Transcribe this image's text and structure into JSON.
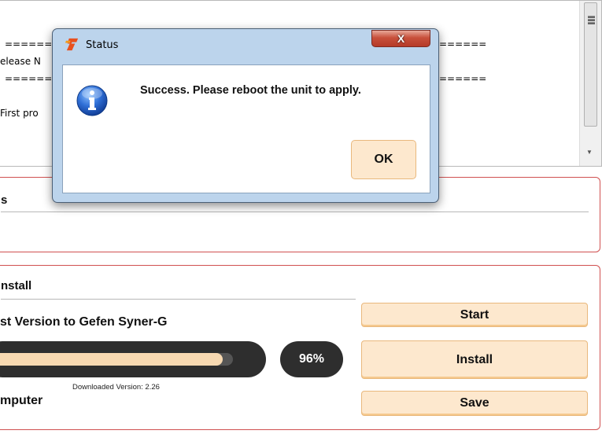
{
  "release_notes": {
    "separator_left": "======",
    "separator_right": "======",
    "release_label_fragment": "elease N",
    "first_line_fragment": "First pro"
  },
  "status_panel": {
    "title_fragment": "s"
  },
  "install_panel": {
    "title_fragment": "nstall",
    "install_latest_label": "st Version to Gefen Syner-G",
    "progress": {
      "fraction": 0.96,
      "label": "96%"
    },
    "downloaded_version": "Downloaded Version: 2.26",
    "computer_label": "mputer",
    "buttons": {
      "start": "Start",
      "install": "Install",
      "save": "Save"
    }
  },
  "dialog": {
    "title": "Status",
    "message": "Success. Please reboot the unit to apply.",
    "ok_label": "OK",
    "close_glyph": "X",
    "icon": "info-icon",
    "logo": "gefen-logo-icon"
  },
  "colors": {
    "accent_button": "#fde8ce",
    "panel_border": "#d05050",
    "progress_fill": "#f7d9b1"
  }
}
